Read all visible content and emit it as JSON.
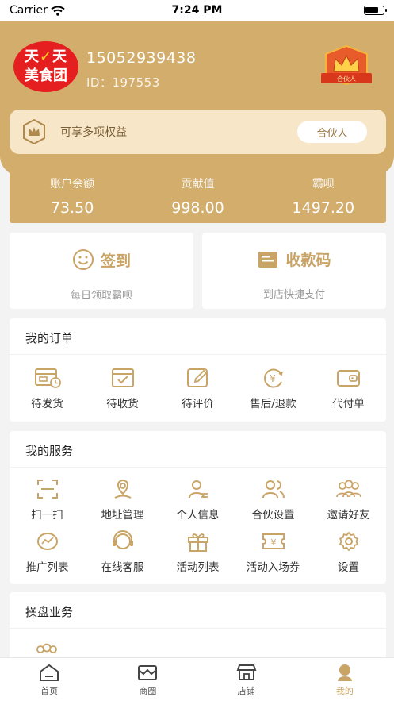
{
  "status_bar": {
    "carrier": "Carrier",
    "time": "7:24 PM"
  },
  "profile": {
    "logo_line1_a": "天",
    "logo_line1_mark": "✓",
    "logo_line1_b": "天",
    "logo_line2": "美食团",
    "phone": "15052939438",
    "id_text": "ID：197553",
    "badge_label": "合伙人"
  },
  "partner_bar": {
    "text": "可享多项权益",
    "button_label": "合伙人"
  },
  "stats": [
    {
      "label": "账户余额",
      "value": "73.50"
    },
    {
      "label": "贡献值",
      "value": "998.00"
    },
    {
      "label": "霸呗",
      "value": "1497.20"
    }
  ],
  "quick_actions": {
    "sign_in": {
      "title": "签到",
      "subtitle": "每日领取霸呗"
    },
    "pay_code": {
      "title": "收款码",
      "subtitle": "到店快捷支付"
    }
  },
  "orders": {
    "title": "我的订单",
    "items": [
      {
        "label": "待发货",
        "icon": "pending-shipment-icon"
      },
      {
        "label": "待收货",
        "icon": "pending-receipt-icon"
      },
      {
        "label": "待评价",
        "icon": "pending-review-icon"
      },
      {
        "label": "售后/退款",
        "icon": "refund-icon"
      },
      {
        "label": "代付单",
        "icon": "wallet-icon"
      }
    ]
  },
  "services": {
    "title": "我的服务",
    "row1": [
      {
        "label": "扫一扫",
        "icon": "scan-icon"
      },
      {
        "label": "地址管理",
        "icon": "address-icon"
      },
      {
        "label": "个人信息",
        "icon": "user-info-icon"
      },
      {
        "label": "合伙设置",
        "icon": "partner-settings-icon"
      },
      {
        "label": "邀请好友",
        "icon": "invite-friends-icon"
      }
    ],
    "row2": [
      {
        "label": "推广列表",
        "icon": "promotion-list-icon"
      },
      {
        "label": "在线客服",
        "icon": "customer-service-icon"
      },
      {
        "label": "活动列表",
        "icon": "gift-icon"
      },
      {
        "label": "活动入场券",
        "icon": "ticket-icon"
      },
      {
        "label": "设置",
        "icon": "gear-icon"
      }
    ]
  },
  "operations": {
    "title": "操盘业务"
  },
  "tabbar": [
    {
      "label": "首页",
      "icon": "home-icon"
    },
    {
      "label": "商圈",
      "icon": "business-district-icon"
    },
    {
      "label": "店铺",
      "icon": "store-icon"
    },
    {
      "label": "我的",
      "icon": "profile-icon",
      "active": true
    }
  ],
  "colors": {
    "gold": "#d2ad6c",
    "gold_text": "#c9a467",
    "logo_red": "#e51f1f"
  }
}
